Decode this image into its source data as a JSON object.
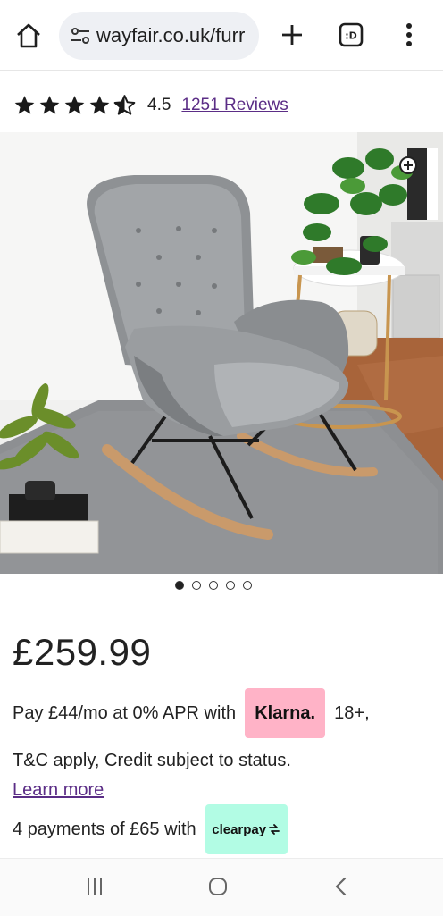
{
  "browser": {
    "url": "wayfair.co.uk/furr",
    "icons": [
      "home-icon",
      "tune-icon",
      "plus-icon",
      "tab-switcher-icon",
      "overflow-menu-icon"
    ]
  },
  "rating": {
    "value": "4.5",
    "stars": 4.5,
    "reviews_label": "1251 Reviews"
  },
  "carousel": {
    "total": 5,
    "active": 1
  },
  "product": {
    "price": "£259.99",
    "image_alt": "Grey velvet rocking chair"
  },
  "finance": {
    "klarna_before": "Pay £44/mo at 0% APR with",
    "klarna_brand": "Klarna.",
    "klarna_after": "18+,",
    "terms": "T&C apply, Credit subject to status.",
    "learn_more": "Learn more",
    "clearpay_before": "4 payments of £65 with",
    "clearpay_brand": "clearpay"
  },
  "colors": {
    "link": "#5b2d86",
    "klarna": "#ffb3c7",
    "clearpay": "#b2fce4"
  },
  "system_nav": {
    "icons": [
      "recents-icon",
      "home-circle-icon",
      "back-icon"
    ]
  }
}
